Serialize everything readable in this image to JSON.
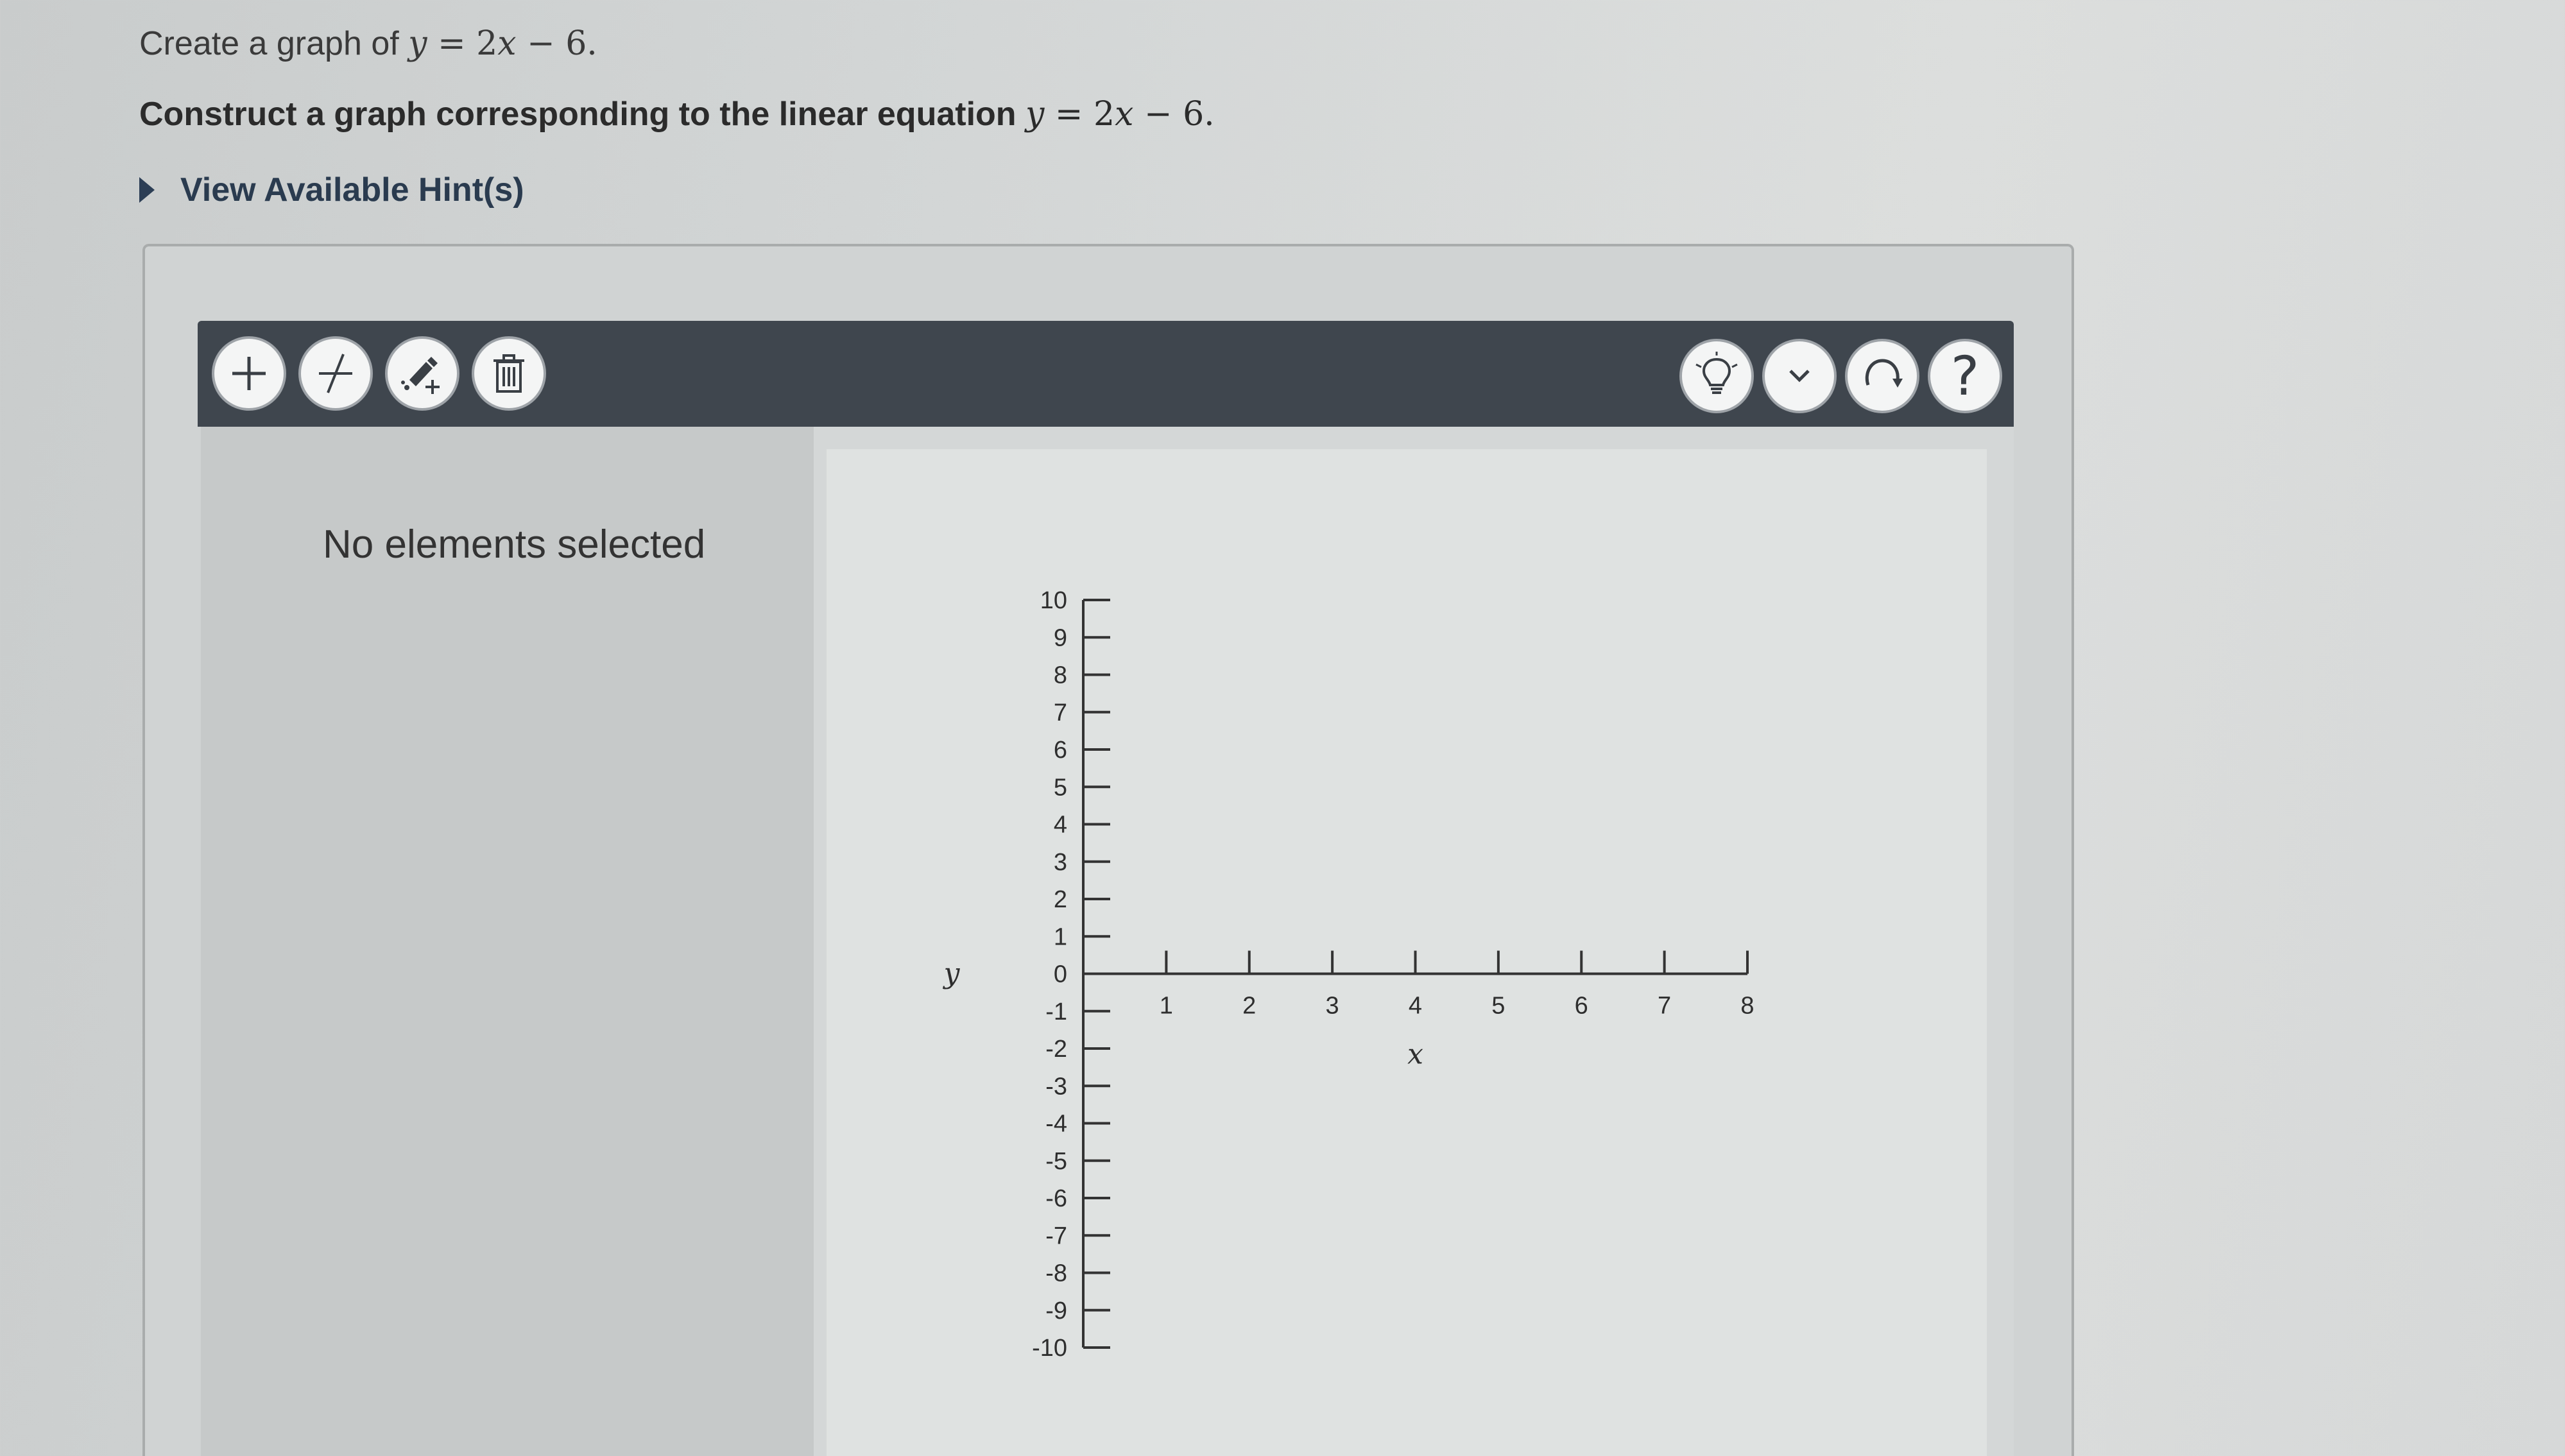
{
  "question": {
    "title_prefix": "Create a graph of ",
    "title_equation": {
      "lhs": "y",
      "eq": " = 2",
      "var": "x",
      "rest": " − 6."
    },
    "instruction_prefix": "Construct a graph corresponding to the linear equation ",
    "instruction_equation": {
      "lhs": "y",
      "eq": " = 2",
      "var": "x",
      "rest": " − 6."
    }
  },
  "hint": {
    "label": "View Available Hint(s)"
  },
  "toolbar": {
    "left_tools": [
      {
        "name": "add-point-button",
        "icon": "plus-icon"
      },
      {
        "name": "draw-line-button",
        "icon": "line-tool-icon"
      },
      {
        "name": "edit-element-button",
        "icon": "pen-plus-icon"
      },
      {
        "name": "delete-button",
        "icon": "trash-icon"
      }
    ],
    "right_tools": [
      {
        "name": "hint-button",
        "icon": "lightbulb-icon"
      },
      {
        "name": "options-dropdown-button",
        "icon": "chevron-down-icon"
      },
      {
        "name": "reset-button",
        "icon": "redo-icon"
      },
      {
        "name": "help-button",
        "icon": "question-icon",
        "label": "?"
      }
    ]
  },
  "properties_panel": {
    "empty_text": "No elements selected"
  },
  "graph": {
    "x_axis": {
      "label": "x",
      "min": 0,
      "max": 8,
      "ticks": [
        "1",
        "2",
        "3",
        "4",
        "5",
        "6",
        "7",
        "8"
      ]
    },
    "y_axis": {
      "label": "y",
      "min": -10,
      "max": 10,
      "ticks": [
        "10",
        "9",
        "8",
        "7",
        "6",
        "5",
        "4",
        "3",
        "2",
        "1",
        "0",
        "-1",
        "-2",
        "-3",
        "-4",
        "-5",
        "-6",
        "-7",
        "-8",
        "-9",
        "-10"
      ]
    }
  },
  "colors": {
    "toolbar_bg": "#3f464e",
    "link_text": "#2a3b4f"
  }
}
